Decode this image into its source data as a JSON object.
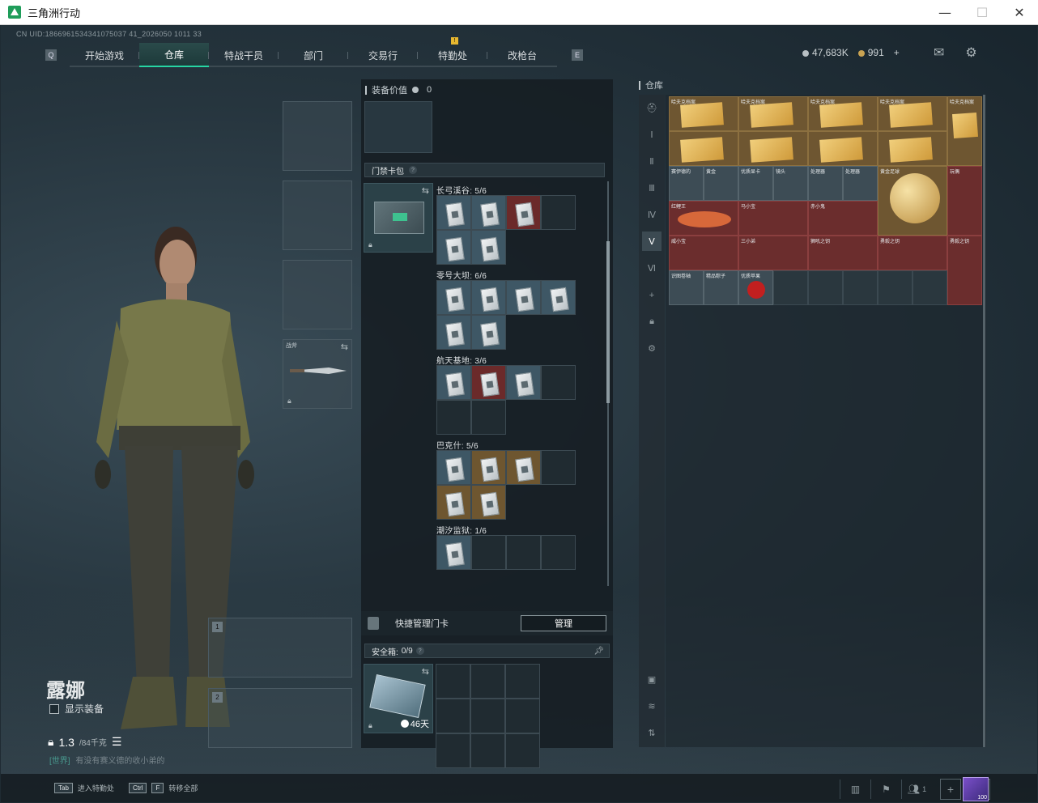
{
  "window": {
    "title": "三角洲行动",
    "minimize": "—",
    "maximize": "☐",
    "close": "✕"
  },
  "uid": "CN UID:1866961534341075037 41_2026050 1011 33",
  "nav": {
    "tabs": [
      {
        "label": "开始游戏"
      },
      {
        "label": "仓库",
        "active": true
      },
      {
        "label": "特战干员"
      },
      {
        "label": "部门"
      },
      {
        "label": "交易行"
      },
      {
        "label": "特勤处",
        "badge": "!"
      },
      {
        "label": "改枪台"
      }
    ]
  },
  "currency": {
    "silver": "47,683K",
    "gold": "991",
    "add": "+"
  },
  "character": {
    "name": "露娜",
    "show_equipment": "显示装备",
    "weight_value": "1.3",
    "weight_max": "/84千克",
    "chat_channel": "[世界]",
    "chat_text": "有没有赛义德的收小弟的"
  },
  "equipment": {
    "melee_label": "战斧",
    "weapon1": "1",
    "weapon2": "2"
  },
  "loadout": {
    "title": "装备价值",
    "value": "0",
    "keycard_header": "门禁卡包",
    "regions": [
      {
        "title": "长弓溪谷: 5/6"
      },
      {
        "title": "零号大坝: 6/6"
      },
      {
        "title": "航天基地: 3/6"
      },
      {
        "title": "巴克什: 5/6"
      },
      {
        "title": "潮汐监狱: 1/6"
      }
    ],
    "quick_manage": "快捷管理门卡",
    "manage_button": "管理",
    "safebox_title": "安全箱:",
    "safebox_count": "0/9",
    "safebox_days": "46天"
  },
  "stash": {
    "title": "仓库",
    "row1": [
      "哈夫克档案",
      "哈夫克档案",
      "哈夫克档案",
      "哈夫克档案",
      "哈夫克档案"
    ],
    "row3": [
      "赛伊德的",
      "黄金",
      "优质显卡",
      "镜头",
      "处理器",
      "处理器",
      "黄金足球",
      "",
      "玩偶"
    ],
    "row4": [
      "红鲤王",
      "",
      "马小宝",
      "",
      "赤小鬼",
      "",
      "",
      "",
      ""
    ],
    "row5": [
      "威小宝",
      "",
      "三小弟",
      "",
      "狮吼之钥",
      "",
      "勇毅之钥",
      "",
      "勇毅之钥"
    ],
    "row6": [
      "识图卷轴",
      "精品粽子",
      "优质苹果"
    ]
  },
  "bottom": {
    "tab_key": "Tab",
    "tab_hint": "进入特勤处",
    "ctrl_key": "Ctrl",
    "f_key": "F",
    "ctrl_hint": "转移全部",
    "friends": "1",
    "avatar_label": "100"
  }
}
